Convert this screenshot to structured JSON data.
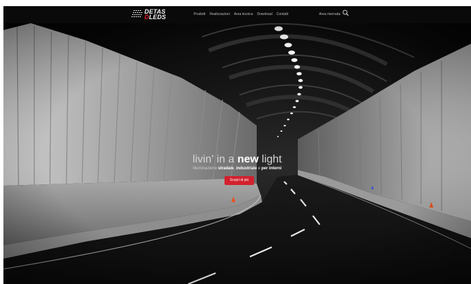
{
  "brand": {
    "line1": "DETAS",
    "line2_prefix": "D",
    "line2_rest": "LEDS",
    "accent": "#e11d2c"
  },
  "nav": {
    "items": [
      "Prodotti",
      "Realizzazioni",
      "Area tecnica",
      "Download",
      "Contatti"
    ],
    "reserved_area": "Area riservata",
    "search_icon": "search-icon"
  },
  "hero": {
    "headline_pre": "livin' in a ",
    "headline_bold": "new",
    "headline_post": " light",
    "sub_pre": "Illuminazione ",
    "sub_bold1": "stradale",
    "sub_mid": ", ",
    "sub_bold2": "industriale",
    "sub_mid2": " e ",
    "sub_bold3": "per interni",
    "cta": "Scopri di più",
    "cta_color": "#d3202d"
  }
}
